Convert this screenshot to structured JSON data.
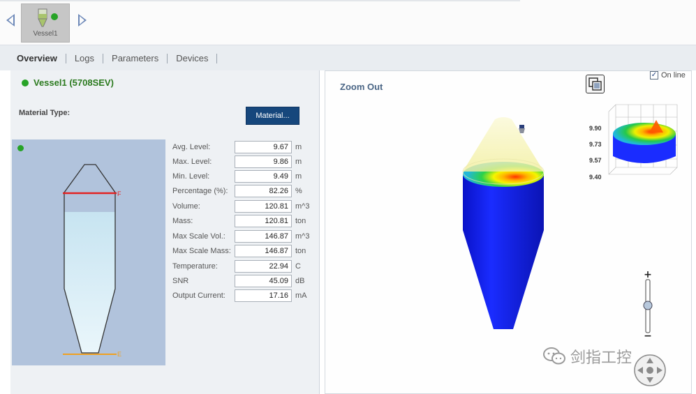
{
  "app": {
    "device_tile": {
      "label": "Vessel1",
      "icon": "vessel-device-icon"
    }
  },
  "tabs": [
    {
      "label": "Overview",
      "active": true
    },
    {
      "label": "Logs",
      "active": false
    },
    {
      "label": "Parameters",
      "active": false
    },
    {
      "label": "Devices",
      "active": false
    }
  ],
  "overview": {
    "vessel_title": "Vessel1 (5708SEV)",
    "material_type_label": "Material Type:",
    "material_button": "Material...",
    "readouts": [
      {
        "label": "Avg. Level:",
        "value": "9.67",
        "unit": "m"
      },
      {
        "label": "Max. Level:",
        "value": "9.86",
        "unit": "m"
      },
      {
        "label": "Min. Level:",
        "value": "9.49",
        "unit": "m"
      },
      {
        "label": "Percentage (%):",
        "value": "82.26",
        "unit": "%"
      },
      {
        "label": "Volume:",
        "value": "120.81",
        "unit": "m^3"
      },
      {
        "label": "Mass:",
        "value": "120.81",
        "unit": "ton"
      },
      {
        "label": "Max Scale Vol.:",
        "value": "146.87",
        "unit": "m^3"
      },
      {
        "label": "Max Scale Mass:",
        "value": "146.87",
        "unit": "ton"
      },
      {
        "label": "Temperature:",
        "value": "22.94",
        "unit": "C"
      },
      {
        "label": "SNR",
        "value": "45.09",
        "unit": "dB"
      },
      {
        "label": "Output Current:",
        "value": "17.16",
        "unit": "mA"
      }
    ],
    "level_markers": {
      "full": "F",
      "empty": "E"
    },
    "fill_fraction": 0.8226
  },
  "view3d": {
    "title": "Zoom Out",
    "online_label": "On line",
    "online_checked": true,
    "axis_labels": [
      "9.90",
      "9.73",
      "9.57",
      "9.40"
    ]
  },
  "watermark": {
    "text": "剑指工控"
  },
  "colors": {
    "status_green": "#27a327",
    "button_blue": "#16477c",
    "level_red": "#e32222",
    "level_orange": "#f0a020",
    "material_blue": "#1420e6"
  }
}
